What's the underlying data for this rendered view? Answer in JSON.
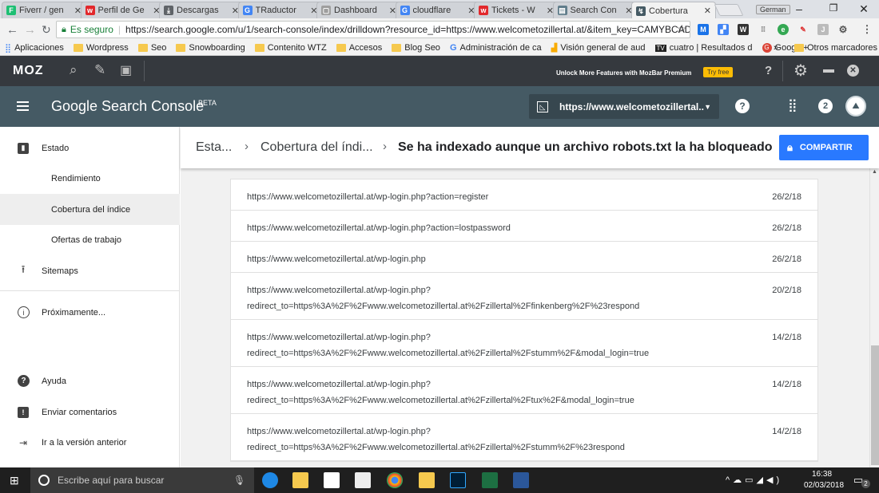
{
  "browser": {
    "tabs": [
      {
        "title": "Fiverr / gen",
        "fav": "F",
        "color": "#1dbf73"
      },
      {
        "title": "Perfil de Ge",
        "fav": "w",
        "color": "#e2282c"
      },
      {
        "title": "Descargas",
        "fav": "⤓",
        "color": "#5f6368"
      },
      {
        "title": "TRaductor",
        "fav": "G",
        "color": "#4285f4"
      },
      {
        "title": "Dashboard",
        "fav": "▢",
        "color": "#9e9e9e"
      },
      {
        "title": "cloudflare",
        "fav": "G",
        "color": "#4285f4"
      },
      {
        "title": "Tickets - W",
        "fav": "w",
        "color": "#e2282c"
      },
      {
        "title": "Search Con",
        "fav": "▤",
        "color": "#607d8b"
      },
      {
        "title": "Cobertura",
        "fav": "↯",
        "color": "#455a64"
      }
    ],
    "profile_name": "German",
    "secure_label": "Es seguro",
    "url": "https://search.google.com/u/1/search-console/index/drilldown?resource_id=https://www.welcometozillertal.at/&item_key=CAMYBCAD...",
    "bookmarks": [
      {
        "label": "Aplicaciones",
        "kind": "apps"
      },
      {
        "label": "Wordpress",
        "kind": "folder"
      },
      {
        "label": "Seo",
        "kind": "folder"
      },
      {
        "label": "Snowboarding",
        "kind": "folder"
      },
      {
        "label": "Contenito WTZ",
        "kind": "folder"
      },
      {
        "label": "Accesos",
        "kind": "folder"
      },
      {
        "label": "Blog Seo",
        "kind": "folder"
      },
      {
        "label": "Administración de ca",
        "kind": "google"
      },
      {
        "label": "Visión general de aud",
        "kind": "analytics"
      },
      {
        "label": "cuatro | Resultados d",
        "kind": "tv"
      },
      {
        "label": "Google+",
        "kind": "gplus"
      }
    ],
    "more_bookmarks": "»",
    "other_bookmarks": "Otros marcadores"
  },
  "moz": {
    "logo": "MOZ",
    "promo": "Unlock More Features with MozBar Premium",
    "try_free": "Try free",
    "help": "?"
  },
  "console": {
    "title": "Google Search Console",
    "beta": "BETA",
    "property": "https://www.welcometozillertal...",
    "notif_count": "2"
  },
  "sidebar": {
    "status": "Estado",
    "performance": "Rendimiento",
    "coverage": "Cobertura del índice",
    "jobs": "Ofertas de trabajo",
    "sitemaps": "Sitemaps",
    "coming_soon": "Próximamente...",
    "help": "Ayuda",
    "feedback": "Enviar comentarios",
    "old_version": "Ir a la versión anterior"
  },
  "breadcrumb": {
    "b1": "Esta...",
    "b2": "Cobertura del índi...",
    "current": "Se ha indexado aunque un archivo robots.txt la ha bloqueado",
    "share": "COMPARTIR"
  },
  "rows": [
    {
      "url": "https://www.welcometozillertal.at/wp-login.php?action=register",
      "url2": "",
      "date": "26/2/18"
    },
    {
      "url": "https://www.welcometozillertal.at/wp-login.php?action=lostpassword",
      "url2": "",
      "date": "26/2/18"
    },
    {
      "url": "https://www.welcometozillertal.at/wp-login.php",
      "url2": "",
      "date": "26/2/18"
    },
    {
      "url": "https://www.welcometozillertal.at/wp-login.php?",
      "url2": "redirect_to=https%3A%2F%2Fwww.welcometozillertal.at%2Fzillertal%2Ffinkenberg%2F%23respond",
      "date": "20/2/18"
    },
    {
      "url": "https://www.welcometozillertal.at/wp-login.php?",
      "url2": "redirect_to=https%3A%2F%2Fwww.welcometozillertal.at%2Fzillertal%2Fstumm%2F&modal_login=true",
      "date": "14/2/18"
    },
    {
      "url": "https://www.welcometozillertal.at/wp-login.php?",
      "url2": "redirect_to=https%3A%2F%2Fwww.welcometozillertal.at%2Fzillertal%2Ftux%2F&modal_login=true",
      "date": "14/2/18"
    },
    {
      "url": "https://www.welcometozillertal.at/wp-login.php?",
      "url2": "redirect_to=https%3A%2F%2Fwww.welcometozillertal.at%2Fzillertal%2Fstumm%2F%23respond",
      "date": "14/2/18"
    }
  ],
  "taskbar": {
    "search_placeholder": "Escribe aquí para buscar",
    "time": "16:38",
    "date": "02/03/2018",
    "notif_count": "2"
  }
}
